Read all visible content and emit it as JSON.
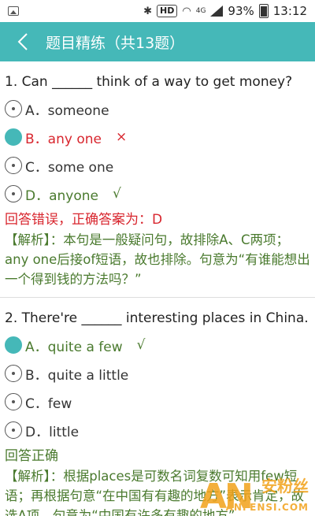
{
  "status_bar": {
    "hd": "HD",
    "network": "4G",
    "battery": "93%",
    "time": "13:12"
  },
  "header": {
    "title": "题目精练（共13题）"
  },
  "questions": [
    {
      "text": "1. Can ______ think of a way to get money?",
      "options": [
        {
          "label": "A．someone",
          "state": "normal"
        },
        {
          "label": "B．any one",
          "state": "wrong",
          "mark": "×"
        },
        {
          "label": "C．some one",
          "state": "normal"
        },
        {
          "label": "D．anyone",
          "state": "correct",
          "mark": "√"
        }
      ],
      "result": "回答错误，正确答案为：D",
      "analysis": "【解析】：本句是一般疑问句，故排除A、C两项；any one后接of短语，故也排除。句意为“有谁能想出一个得到钱的方法吗？”"
    },
    {
      "text": "2. There're ______ interesting places in China.",
      "options": [
        {
          "label": "A．quite a few",
          "state": "correct",
          "mark": "√"
        },
        {
          "label": "B．quite a little",
          "state": "normal"
        },
        {
          "label": "C．few",
          "state": "normal"
        },
        {
          "label": "D．little",
          "state": "normal"
        }
      ],
      "result": "回答正确",
      "analysis": "【解析】：根据places是可数名词复数可知用few短语；再根据句意“在中国有有趣的地方”表示肯定，故选A项。句意为“中国有许多有趣的地方”"
    }
  ],
  "watermark": {
    "logo": "AN",
    "cn": "安粉丝",
    "site": "ANFENSI.COM"
  },
  "colors": {
    "accent": "#45b8b8",
    "wrong": "#d8262e",
    "correct": "#4a7a2e"
  }
}
